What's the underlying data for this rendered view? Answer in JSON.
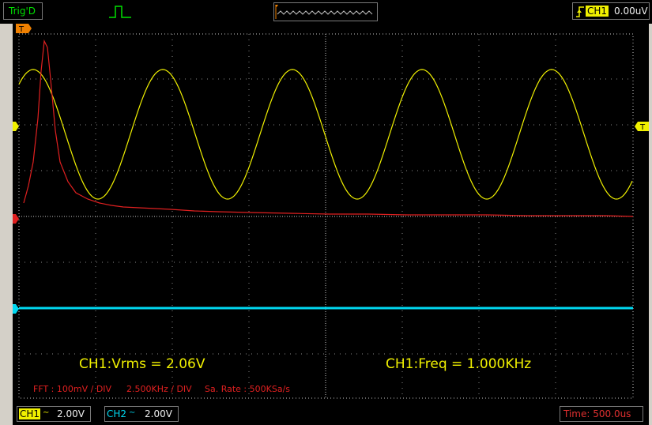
{
  "status": {
    "trigger_state": "Trig'D"
  },
  "trigger": {
    "channel": "CH1",
    "level": "0.00uV"
  },
  "markers": {
    "time_marker": "T",
    "ch1_marker": "1",
    "ch2_marker": "2",
    "math_marker": "M",
    "trigger_level_marker": "T"
  },
  "measurements": {
    "vrms": "CH1:Vrms = 2.06V",
    "freq": "CH1:Freq = 1.000KHz"
  },
  "fft": {
    "scale": "FFT :  100mV / DIV",
    "freq_div": "2.500KHz / DIV",
    "sample_rate": "Sa. Rate : 500KSa/s"
  },
  "channels": {
    "ch1": {
      "label": "CH1",
      "volts_div": "2.00V"
    },
    "ch2": {
      "label": "CH2",
      "volts_div": "2.00V"
    }
  },
  "timebase": {
    "text": "Time: 500.0us"
  },
  "colors": {
    "ch1": "#f0f000",
    "ch2": "#00d8f0",
    "math": "#e02020",
    "grid": "#c8c8c8",
    "background": "#000000"
  }
}
